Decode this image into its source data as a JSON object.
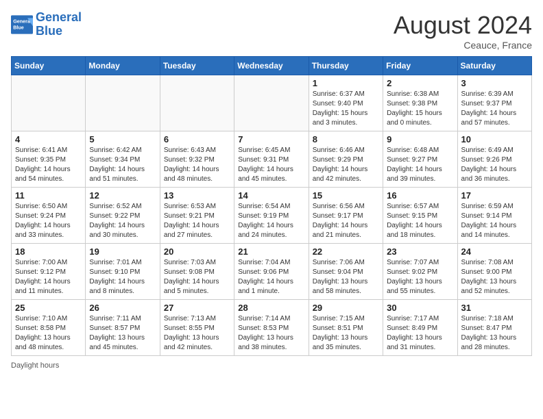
{
  "header": {
    "logo_general": "General",
    "logo_blue": "Blue",
    "month_year": "August 2024",
    "location": "Ceauce, France"
  },
  "days_of_week": [
    "Sunday",
    "Monday",
    "Tuesday",
    "Wednesday",
    "Thursday",
    "Friday",
    "Saturday"
  ],
  "weeks": [
    [
      {
        "day": "",
        "info": ""
      },
      {
        "day": "",
        "info": ""
      },
      {
        "day": "",
        "info": ""
      },
      {
        "day": "",
        "info": ""
      },
      {
        "day": "1",
        "info": "Sunrise: 6:37 AM\nSunset: 9:40 PM\nDaylight: 15 hours and 3 minutes."
      },
      {
        "day": "2",
        "info": "Sunrise: 6:38 AM\nSunset: 9:38 PM\nDaylight: 15 hours and 0 minutes."
      },
      {
        "day": "3",
        "info": "Sunrise: 6:39 AM\nSunset: 9:37 PM\nDaylight: 14 hours and 57 minutes."
      }
    ],
    [
      {
        "day": "4",
        "info": "Sunrise: 6:41 AM\nSunset: 9:35 PM\nDaylight: 14 hours and 54 minutes."
      },
      {
        "day": "5",
        "info": "Sunrise: 6:42 AM\nSunset: 9:34 PM\nDaylight: 14 hours and 51 minutes."
      },
      {
        "day": "6",
        "info": "Sunrise: 6:43 AM\nSunset: 9:32 PM\nDaylight: 14 hours and 48 minutes."
      },
      {
        "day": "7",
        "info": "Sunrise: 6:45 AM\nSunset: 9:31 PM\nDaylight: 14 hours and 45 minutes."
      },
      {
        "day": "8",
        "info": "Sunrise: 6:46 AM\nSunset: 9:29 PM\nDaylight: 14 hours and 42 minutes."
      },
      {
        "day": "9",
        "info": "Sunrise: 6:48 AM\nSunset: 9:27 PM\nDaylight: 14 hours and 39 minutes."
      },
      {
        "day": "10",
        "info": "Sunrise: 6:49 AM\nSunset: 9:26 PM\nDaylight: 14 hours and 36 minutes."
      }
    ],
    [
      {
        "day": "11",
        "info": "Sunrise: 6:50 AM\nSunset: 9:24 PM\nDaylight: 14 hours and 33 minutes."
      },
      {
        "day": "12",
        "info": "Sunrise: 6:52 AM\nSunset: 9:22 PM\nDaylight: 14 hours and 30 minutes."
      },
      {
        "day": "13",
        "info": "Sunrise: 6:53 AM\nSunset: 9:21 PM\nDaylight: 14 hours and 27 minutes."
      },
      {
        "day": "14",
        "info": "Sunrise: 6:54 AM\nSunset: 9:19 PM\nDaylight: 14 hours and 24 minutes."
      },
      {
        "day": "15",
        "info": "Sunrise: 6:56 AM\nSunset: 9:17 PM\nDaylight: 14 hours and 21 minutes."
      },
      {
        "day": "16",
        "info": "Sunrise: 6:57 AM\nSunset: 9:15 PM\nDaylight: 14 hours and 18 minutes."
      },
      {
        "day": "17",
        "info": "Sunrise: 6:59 AM\nSunset: 9:14 PM\nDaylight: 14 hours and 14 minutes."
      }
    ],
    [
      {
        "day": "18",
        "info": "Sunrise: 7:00 AM\nSunset: 9:12 PM\nDaylight: 14 hours and 11 minutes."
      },
      {
        "day": "19",
        "info": "Sunrise: 7:01 AM\nSunset: 9:10 PM\nDaylight: 14 hours and 8 minutes."
      },
      {
        "day": "20",
        "info": "Sunrise: 7:03 AM\nSunset: 9:08 PM\nDaylight: 14 hours and 5 minutes."
      },
      {
        "day": "21",
        "info": "Sunrise: 7:04 AM\nSunset: 9:06 PM\nDaylight: 14 hours and 1 minute."
      },
      {
        "day": "22",
        "info": "Sunrise: 7:06 AM\nSunset: 9:04 PM\nDaylight: 13 hours and 58 minutes."
      },
      {
        "day": "23",
        "info": "Sunrise: 7:07 AM\nSunset: 9:02 PM\nDaylight: 13 hours and 55 minutes."
      },
      {
        "day": "24",
        "info": "Sunrise: 7:08 AM\nSunset: 9:00 PM\nDaylight: 13 hours and 52 minutes."
      }
    ],
    [
      {
        "day": "25",
        "info": "Sunrise: 7:10 AM\nSunset: 8:58 PM\nDaylight: 13 hours and 48 minutes."
      },
      {
        "day": "26",
        "info": "Sunrise: 7:11 AM\nSunset: 8:57 PM\nDaylight: 13 hours and 45 minutes."
      },
      {
        "day": "27",
        "info": "Sunrise: 7:13 AM\nSunset: 8:55 PM\nDaylight: 13 hours and 42 minutes."
      },
      {
        "day": "28",
        "info": "Sunrise: 7:14 AM\nSunset: 8:53 PM\nDaylight: 13 hours and 38 minutes."
      },
      {
        "day": "29",
        "info": "Sunrise: 7:15 AM\nSunset: 8:51 PM\nDaylight: 13 hours and 35 minutes."
      },
      {
        "day": "30",
        "info": "Sunrise: 7:17 AM\nSunset: 8:49 PM\nDaylight: 13 hours and 31 minutes."
      },
      {
        "day": "31",
        "info": "Sunrise: 7:18 AM\nSunset: 8:47 PM\nDaylight: 13 hours and 28 minutes."
      }
    ]
  ],
  "footer_label": "Daylight hours"
}
